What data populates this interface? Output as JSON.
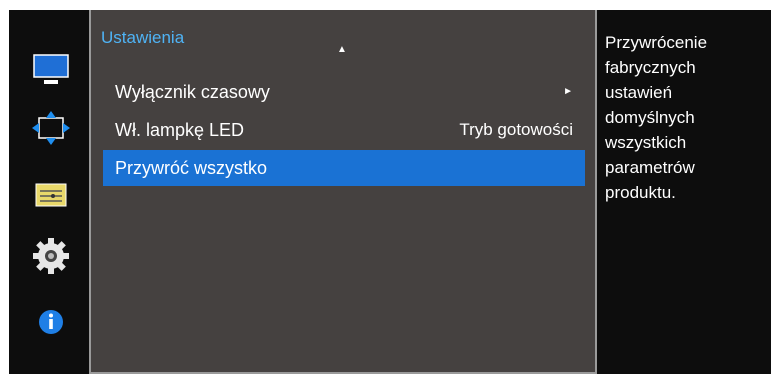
{
  "menu": {
    "title": "Ustawienia",
    "scroll_up_indicator": "▲",
    "items": [
      {
        "label": "Wyłącznik czasowy",
        "submenu_arrow": "►",
        "value": ""
      },
      {
        "label": "Wł. lampkę LED",
        "value": "Tryb gotowości"
      },
      {
        "label": "Przywróć wszystko",
        "value": "",
        "selected": true
      }
    ]
  },
  "sidebar": {
    "icons": [
      "picture-icon",
      "onscreen-display-icon",
      "system-icon",
      "settings-gear-icon",
      "information-icon"
    ],
    "active": "settings-gear-icon"
  },
  "help": {
    "text": "Przywrócenie fabrycznych ustawień domyślnych wszystkich parametrów produktu."
  },
  "colors": {
    "panel_bg": "#454140",
    "highlight": "#1a72d4",
    "title": "#4fb3f5",
    "frame": "#0d0d0d"
  }
}
